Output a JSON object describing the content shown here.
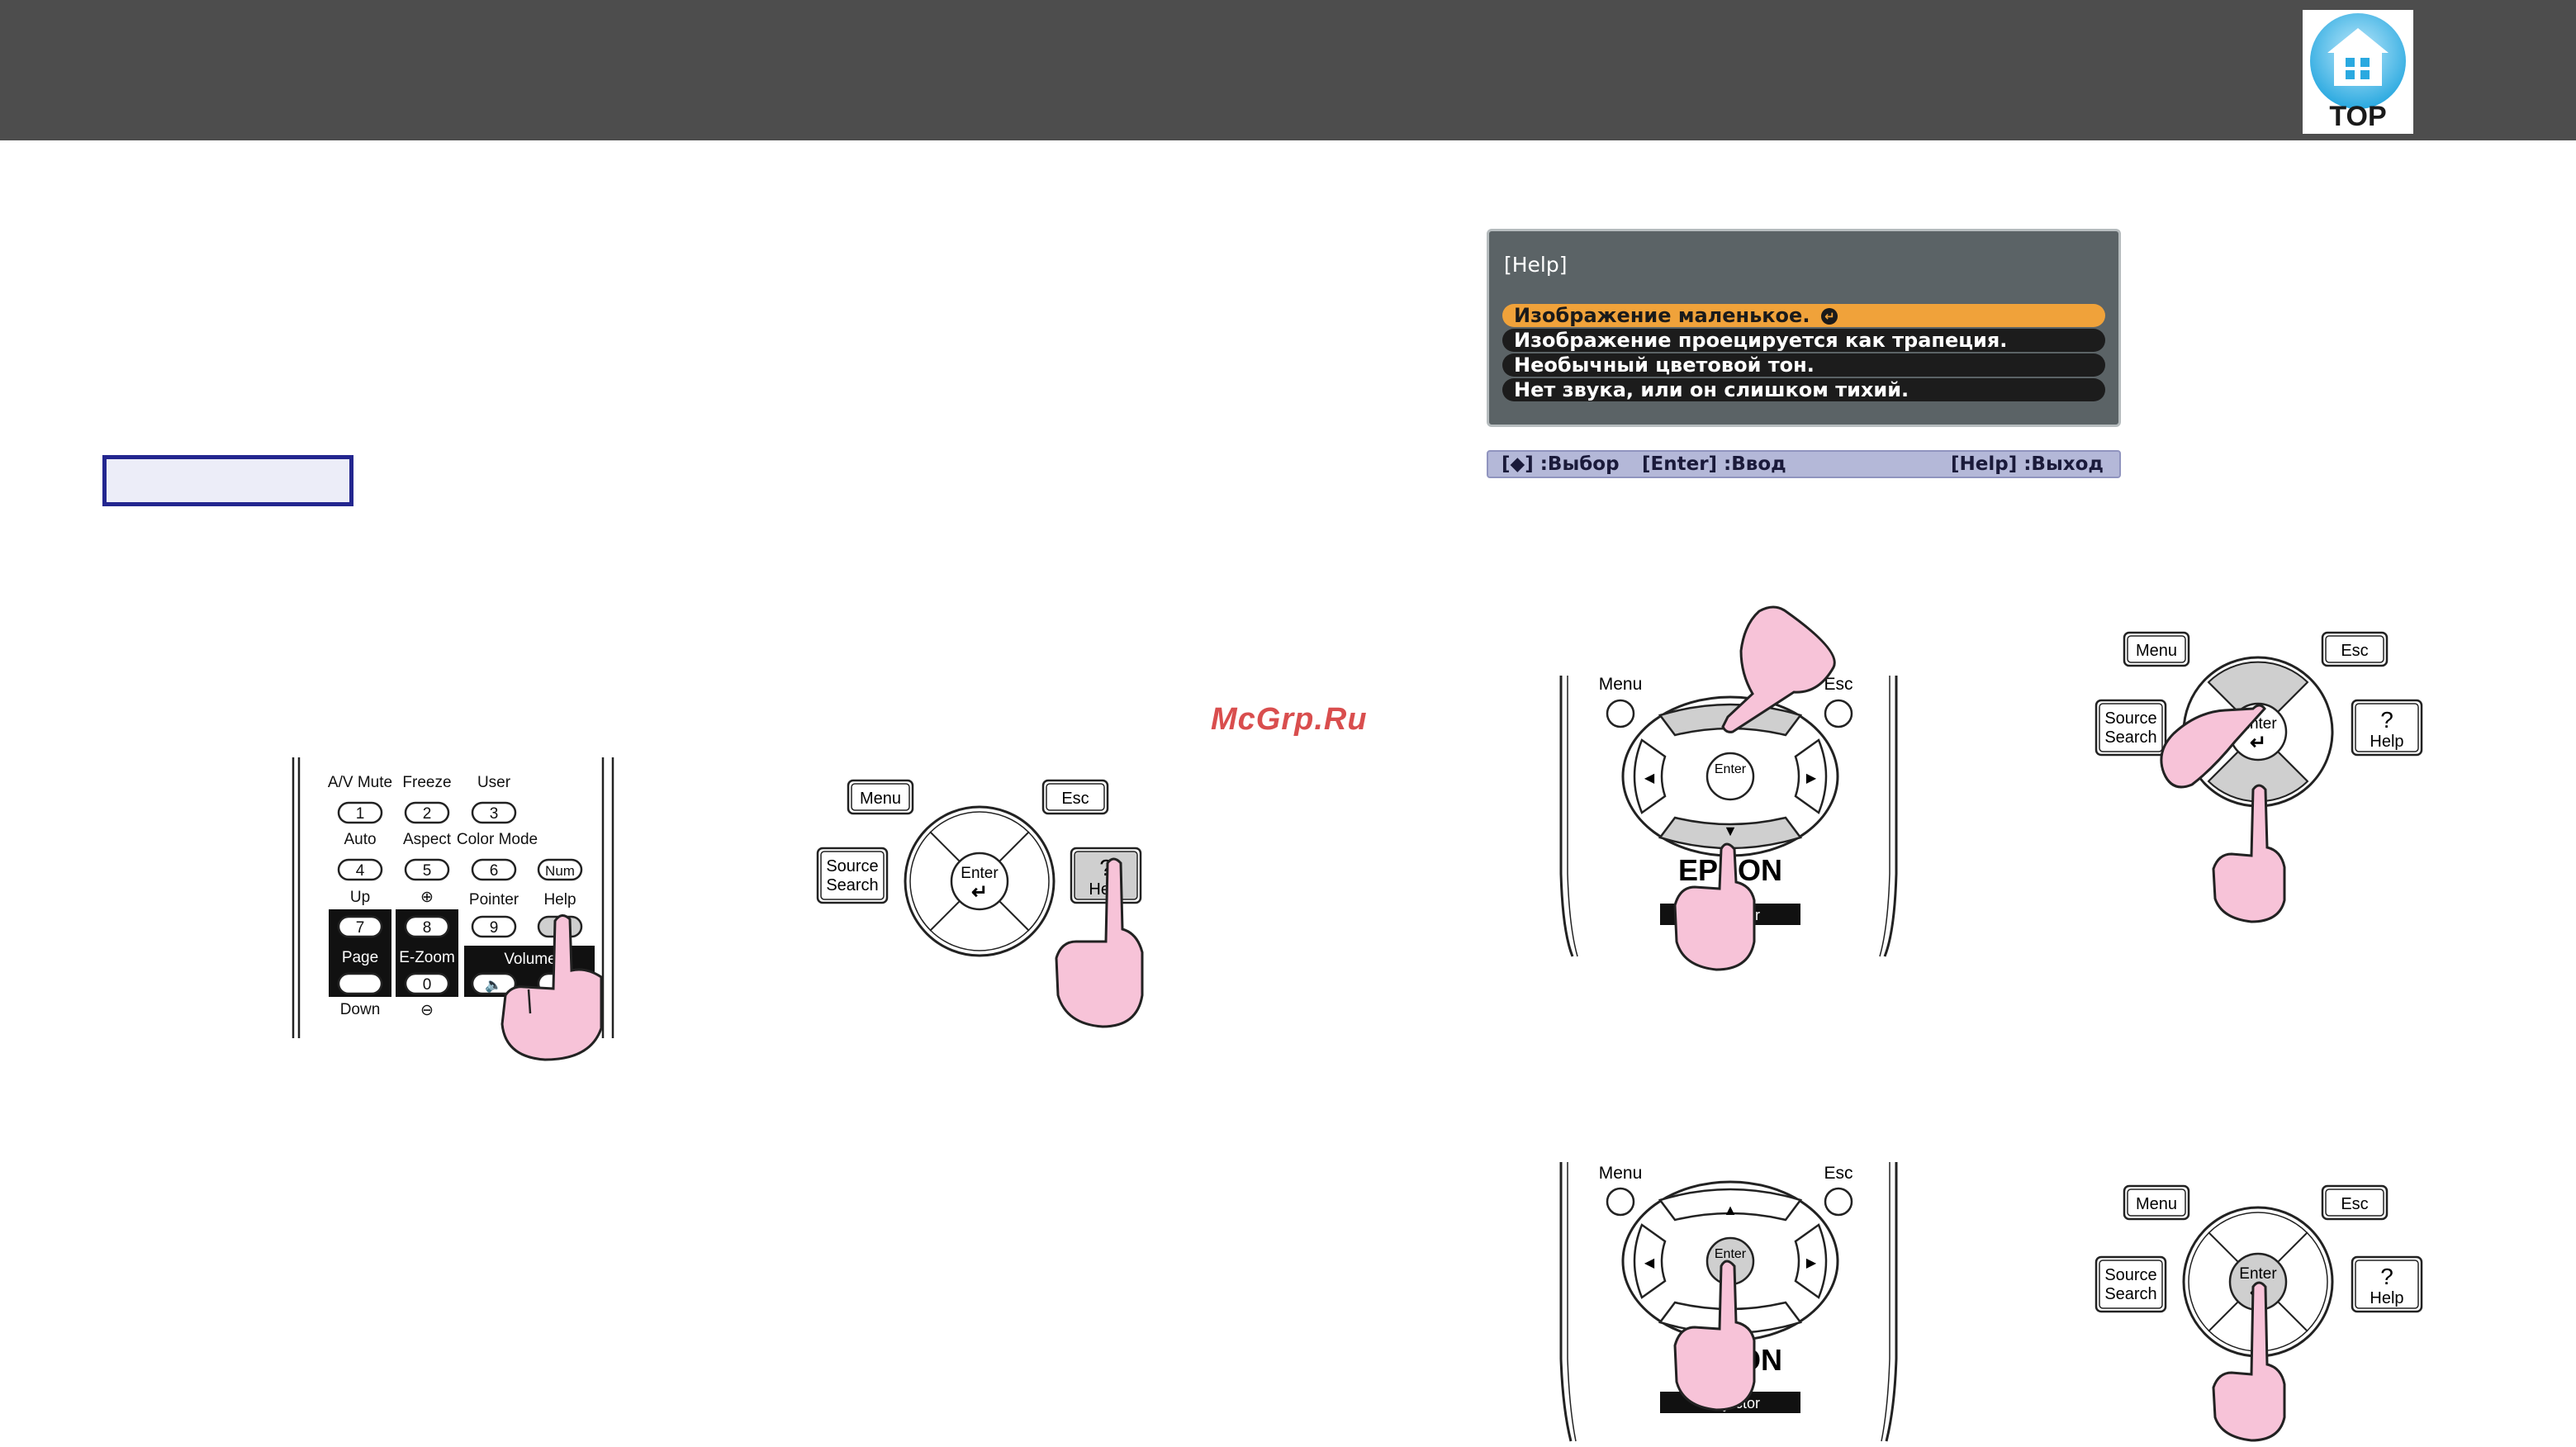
{
  "header": {
    "top_label": "TOP"
  },
  "watermark": "McGrp.Ru",
  "help_screen": {
    "title": "[Help]",
    "items": [
      {
        "label": "Изображение маленькое.",
        "selected": true
      },
      {
        "label": "Изображение проецируется как трапеция.",
        "selected": false
      },
      {
        "label": "Необычный цветовой тон.",
        "selected": false
      },
      {
        "label": "Нет звука, или он слишком тихий.",
        "selected": false
      }
    ],
    "footer": {
      "select": "[◆] :Выбор",
      "enter": "[Enter] :Ввод",
      "exit": "[Help] :Выход"
    }
  },
  "remote_keypad": {
    "row1": {
      "labels": [
        "A/V Mute",
        "Freeze",
        "User"
      ],
      "keys": [
        "1",
        "2",
        "3"
      ]
    },
    "row2": {
      "labels": [
        "Auto",
        "Aspect",
        "Color Mode"
      ],
      "keys": [
        "4",
        "5",
        "6"
      ],
      "num": "Num"
    },
    "row3": {
      "labels": [
        "Up",
        "⊕",
        "Pointer",
        "Help"
      ],
      "keys": [
        "7",
        "8",
        "9",
        "?"
      ]
    },
    "page": "Page",
    "ezoom": "E-Zoom",
    "zero": "0",
    "volume": "Volume",
    "down": "Down",
    "minus": "⊖"
  },
  "control_panel": {
    "menu": "Menu",
    "esc": "Esc",
    "source_line1": "Source",
    "source_line2": "Search",
    "enter": "Enter",
    "help": "Help",
    "question": "?"
  },
  "remote_top": {
    "menu": "Menu",
    "esc": "Esc",
    "enter": "Enter",
    "brand": "EPSON",
    "projector": "Projector"
  },
  "panel_right": {
    "menu": "Menu",
    "esc": "Esc",
    "source_line1": "Source",
    "source_line2": "Search",
    "enter": "Enter",
    "help": "Help",
    "question": "?"
  }
}
